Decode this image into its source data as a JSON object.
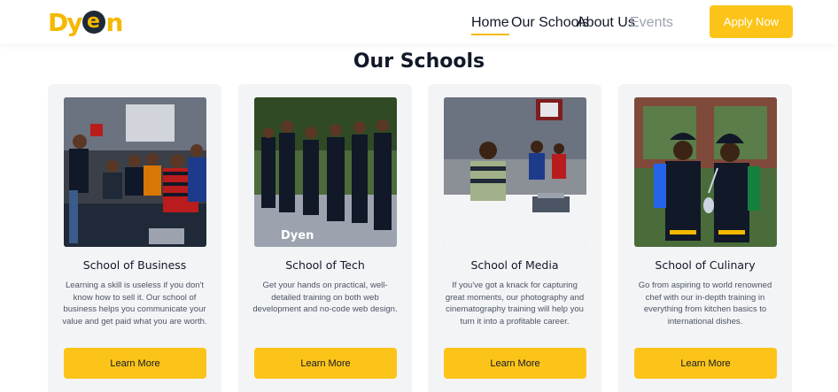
{
  "brand": {
    "logo_text": "Dyen",
    "accent": "#fcc419",
    "dark": "#1f2937"
  },
  "nav": {
    "items": [
      {
        "label": "Home",
        "state": "active"
      },
      {
        "label": "Our Schools",
        "state": "normal"
      },
      {
        "label": "About Us",
        "state": "normal"
      },
      {
        "label": "Events",
        "state": "muted"
      }
    ],
    "apply_label": "Apply Now"
  },
  "section": {
    "title": "Our Schools"
  },
  "schools": [
    {
      "title": "School of Business",
      "description": "Learning a skill is useless if you don't know how to sell it. Our school of business helps you communicate your value and get paid what you are worth.",
      "button": "Learn More",
      "image": "audience-seated-photo"
    },
    {
      "title": "School of Tech",
      "description": "Get your hands on practical, well-detailed training on both web development and no-code web design.",
      "button": "Learn More",
      "image": "group-standing-photo"
    },
    {
      "title": "School of Media",
      "description": "If you've got a knack for capturing great moments, our photography and cinematography training will help you turn it into a profitable career.",
      "button": "Learn More",
      "image": "speaker-at-table-photo"
    },
    {
      "title": "School of Culinary",
      "description": "Go from aspiring to world renowned chef with our in-depth training in everything from kitchen basics to international dishes.",
      "button": "Learn More",
      "image": "two-chefs-photo"
    }
  ]
}
